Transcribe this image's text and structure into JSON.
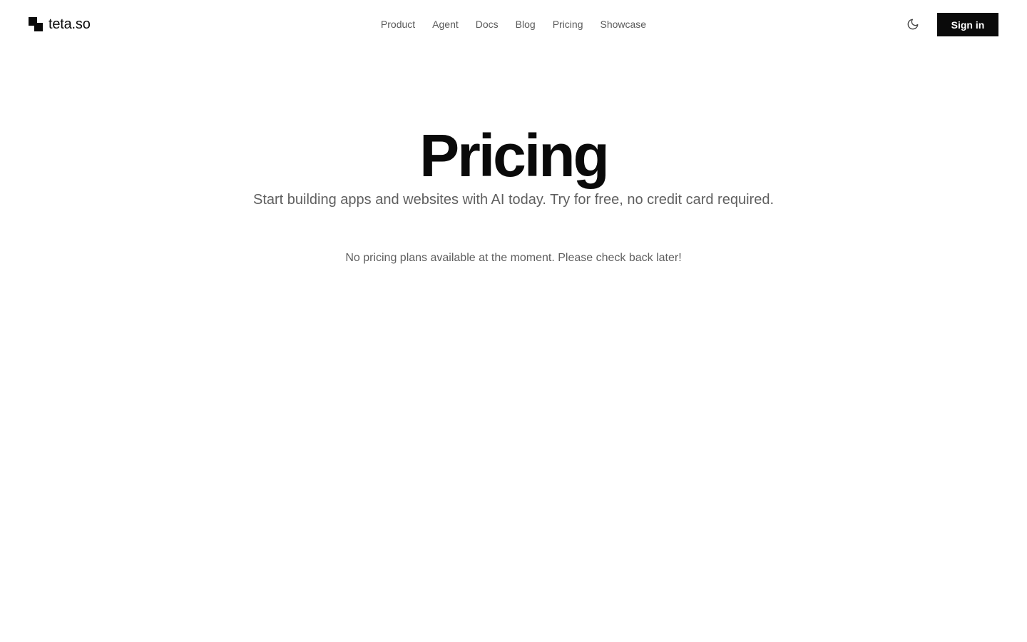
{
  "header": {
    "logo_text": "teta.so",
    "logo_icon": "teta-logo-icon",
    "nav": [
      {
        "label": "Product"
      },
      {
        "label": "Agent"
      },
      {
        "label": "Docs"
      },
      {
        "label": "Blog"
      },
      {
        "label": "Pricing"
      },
      {
        "label": "Showcase"
      }
    ],
    "theme_toggle_icon": "moon-icon",
    "signin_label": "Sign in"
  },
  "hero": {
    "title": "Pricing",
    "subtitle": "Start building apps and websites with AI today. Try for free, no credit card required."
  },
  "main": {
    "empty_message": "No pricing plans available at the moment. Please check back later!"
  },
  "colors": {
    "primary": "#0a0a0a",
    "muted_text": "#5f5f5f",
    "background": "#ffffff"
  }
}
